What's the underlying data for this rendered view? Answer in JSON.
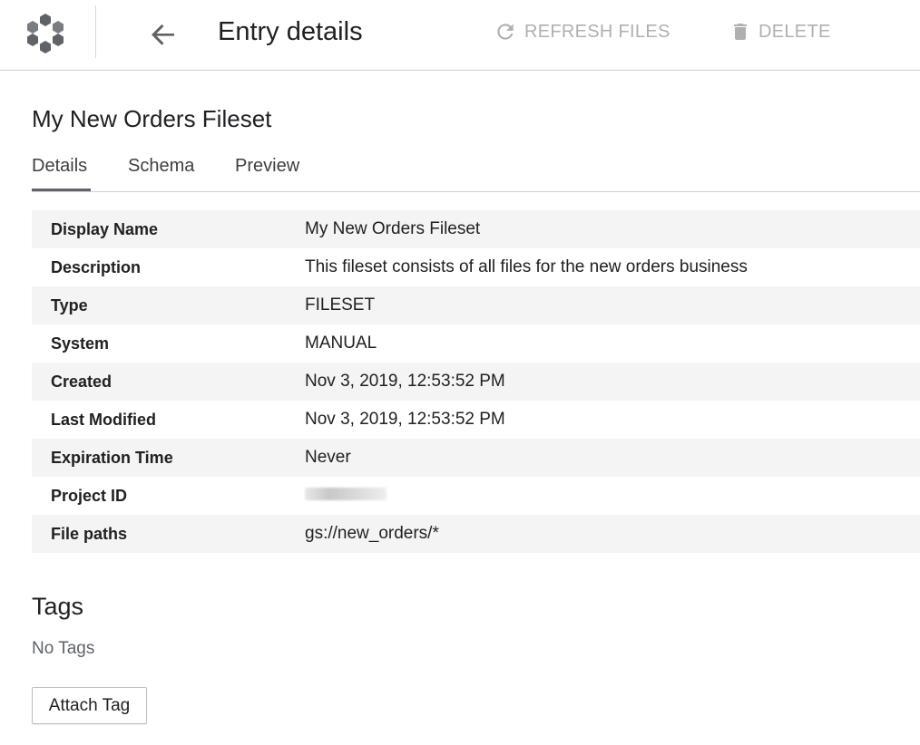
{
  "header": {
    "logo_icon": "data-catalog-hexagon-logo-icon",
    "back_icon": "arrow-left-icon",
    "title": "Entry details",
    "refresh_label": "REFRESH FILES",
    "refresh_icon": "refresh-icon",
    "delete_label": "DELETE",
    "delete_icon": "trash-icon"
  },
  "entry": {
    "name": "My New Orders Fileset"
  },
  "tabs": [
    {
      "label": "Details",
      "active": true
    },
    {
      "label": "Schema",
      "active": false
    },
    {
      "label": "Preview",
      "active": false
    }
  ],
  "details": {
    "display_name": {
      "label": "Display Name",
      "value": "My New Orders Fileset"
    },
    "description": {
      "label": "Description",
      "value": "This fileset consists of all files for the new orders business"
    },
    "type": {
      "label": "Type",
      "value": "FILESET"
    },
    "system": {
      "label": "System",
      "value": "MANUAL"
    },
    "created": {
      "label": "Created",
      "value": "Nov 3, 2019, 12:53:52 PM"
    },
    "last_modified": {
      "label": "Last Modified",
      "value": "Nov 3, 2019, 12:53:52 PM"
    },
    "expiration_time": {
      "label": "Expiration Time",
      "value": "Never"
    },
    "project_id": {
      "label": "Project ID"
    },
    "file_paths": {
      "label": "File paths",
      "value": "gs://new_orders/*"
    }
  },
  "tags": {
    "title": "Tags",
    "empty_text": "No Tags",
    "attach_label": "Attach Tag"
  },
  "colors": {
    "text": "#202124",
    "disabled_action": "#b0b0b0",
    "logo": "#5f6368",
    "row_stripe": "#f4f4f4"
  }
}
